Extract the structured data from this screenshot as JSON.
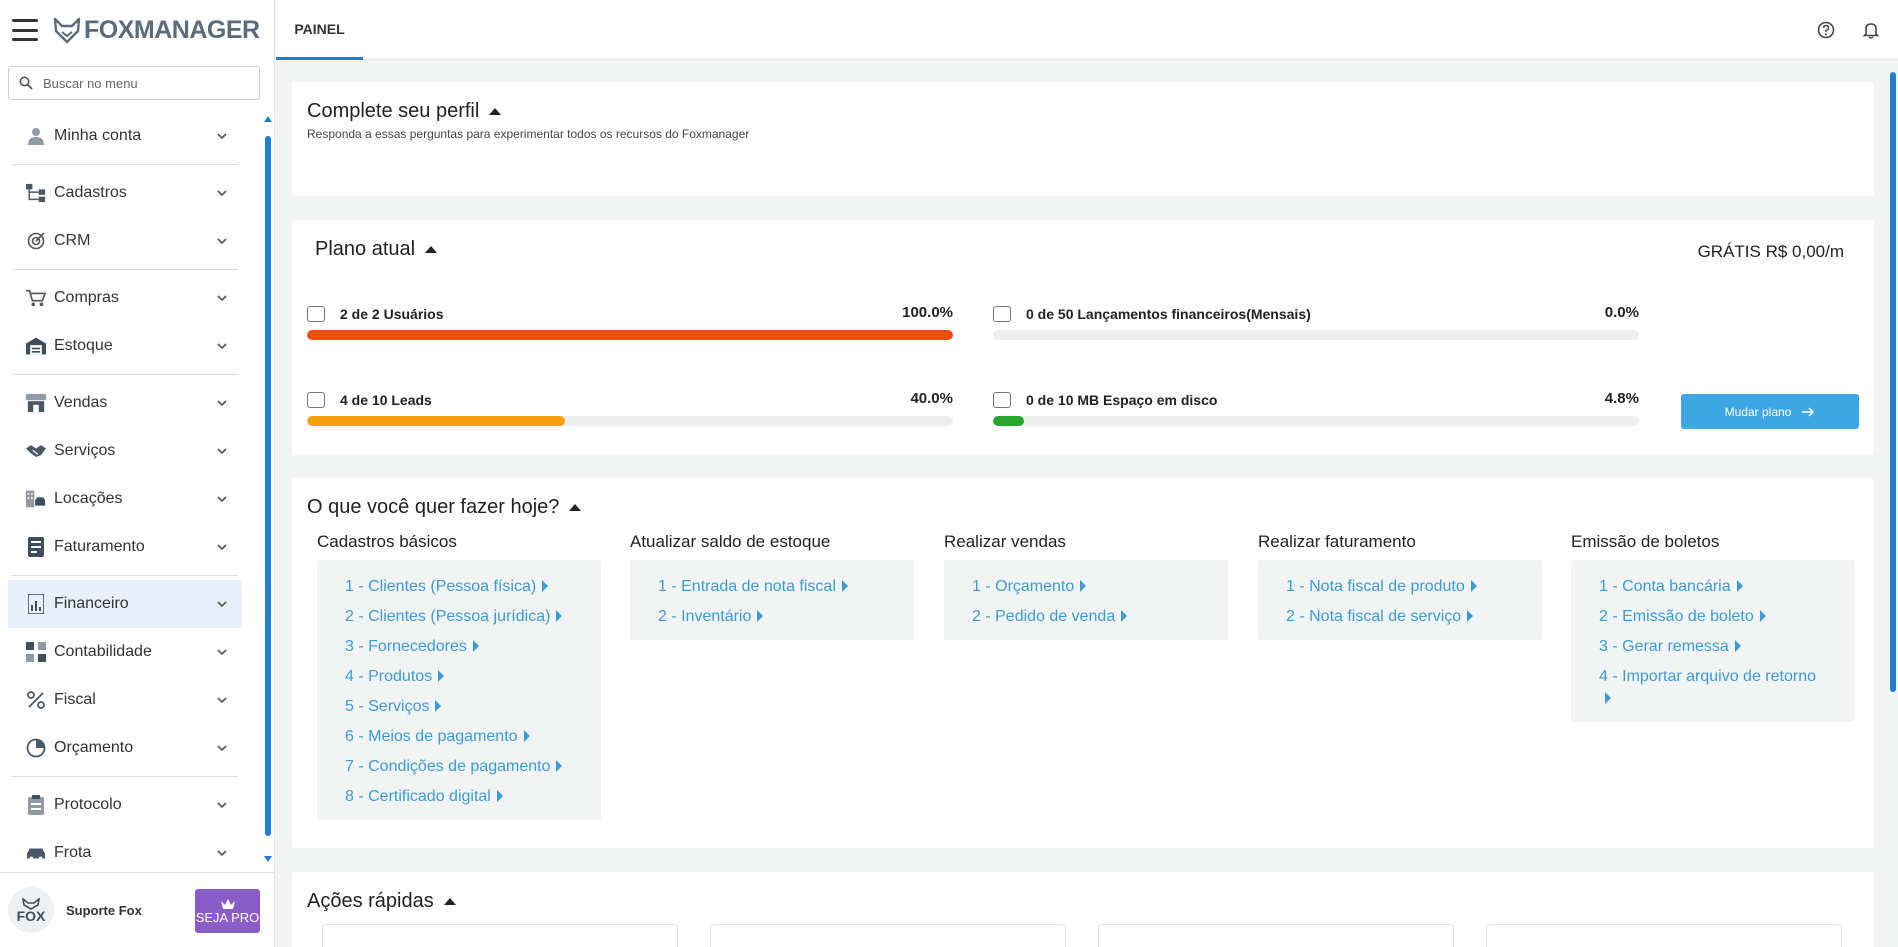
{
  "app": {
    "logo_text": "FOXMANAGER"
  },
  "search": {
    "placeholder": "Buscar no menu"
  },
  "menu": [
    {
      "label": "Minha conta",
      "icon": "user-icon"
    },
    {
      "label": "Cadastros",
      "icon": "hierarchy-icon"
    },
    {
      "label": "CRM",
      "icon": "target-icon"
    },
    {
      "label": "Compras",
      "icon": "cart-icon"
    },
    {
      "label": "Estoque",
      "icon": "warehouse-icon"
    },
    {
      "label": "Vendas",
      "icon": "store-icon"
    },
    {
      "label": "Serviços",
      "icon": "handshake-icon"
    },
    {
      "label": "Locações",
      "icon": "building-car-icon"
    },
    {
      "label": "Faturamento",
      "icon": "invoice-icon"
    },
    {
      "label": "Financeiro",
      "icon": "chart-doc-icon"
    },
    {
      "label": "Contabilidade",
      "icon": "calculator-icon"
    },
    {
      "label": "Fiscal",
      "icon": "percent-icon"
    },
    {
      "label": "Orçamento",
      "icon": "pie-icon"
    },
    {
      "label": "Protocolo",
      "icon": "clipboard-icon"
    },
    {
      "label": "Frota",
      "icon": "car-icon"
    }
  ],
  "footer": {
    "avatar_text": "FOX",
    "support_label": "Suporte Fox",
    "pro_label": "SEJA PRO"
  },
  "header": {
    "tab_label": "PAINEL"
  },
  "profile": {
    "title": "Complete seu perfil",
    "subtitle": "Responda a essas perguntas para experimentar todos os recursos do Foxmanager"
  },
  "plan": {
    "title": "Plano atual",
    "price": "GRÁTIS R$ 0,00/m",
    "change_button": "Mudar plano",
    "usage": [
      {
        "label": "2 de 2 Usuários",
        "percent_text": "100.0%",
        "percent": 100,
        "color": "#f04b0c"
      },
      {
        "label": "0 de 50 Lançamentos financeiros(Mensais)",
        "percent_text": "0.0%",
        "percent": 0,
        "color": "#cccccc"
      },
      {
        "label": "4 de 10 Leads",
        "percent_text": "40.0%",
        "percent": 40,
        "color": "#f7a10f"
      },
      {
        "label": "0 de 10 MB Espaço em disco",
        "percent_text": "4.8%",
        "percent": 4.8,
        "color": "#27a52e"
      }
    ]
  },
  "todo": {
    "title": "O que você quer fazer hoje?",
    "columns": [
      {
        "title": "Cadastros básicos",
        "links": [
          "1 - Clientes (Pessoa física)",
          "2 - Clientes (Pessoa jurídica)",
          "3 - Fornecedores",
          "4 - Produtos",
          "5 - Serviços",
          "6 - Meios de pagamento",
          "7 - Condições de pagamento",
          "8 - Certificado digital"
        ]
      },
      {
        "title": "Atualizar saldo de estoque",
        "links": [
          "1 - Entrada de nota fiscal",
          "2 - Inventário"
        ]
      },
      {
        "title": "Realizar vendas",
        "links": [
          "1 - Orçamento",
          "2 - Pedido de venda"
        ]
      },
      {
        "title": "Realizar faturamento",
        "links": [
          "1 - Nota fiscal de produto",
          "2 - Nota fiscal de serviço"
        ]
      },
      {
        "title": "Emissão de boletos",
        "links": [
          "1 - Conta bancária",
          "2 - Emissão de boleto",
          "3 - Gerar remessa",
          "4 - Importar arquivo de retorno"
        ]
      }
    ]
  },
  "quick": {
    "title": "Ações rápidas"
  }
}
